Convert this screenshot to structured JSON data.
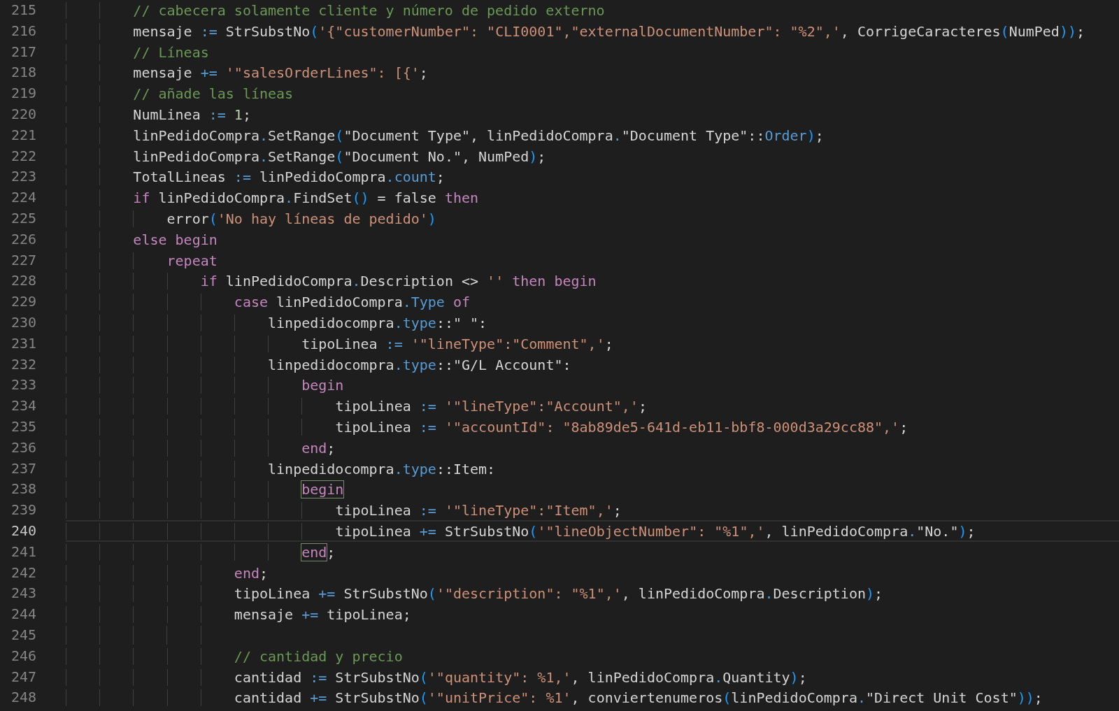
{
  "editor": {
    "lines": [
      {
        "number": "215",
        "current": false,
        "tokens": [
          {
            "text": "        // cabecera solamente cliente y número de pedido externo",
            "kind": "c"
          }
        ]
      },
      {
        "number": "216",
        "current": false,
        "tokens": [
          {
            "text": "        mensaje",
            "kind": "p"
          },
          {
            "text": " := ",
            "kind": "o"
          },
          {
            "text": "StrSubstNo",
            "kind": "p"
          },
          {
            "text": "(",
            "kind": "b"
          },
          {
            "text": "'{\"customerNumber\": \"CLI0001\",\"externalDocumentNumber\": \"%2\",'",
            "kind": "s"
          },
          {
            "text": ", CorrigeCaracteres",
            "kind": "p"
          },
          {
            "text": "(",
            "kind": "b"
          },
          {
            "text": "NumPed",
            "kind": "p"
          },
          {
            "text": "))",
            "kind": "b"
          },
          {
            "text": ";",
            "kind": "p"
          }
        ]
      },
      {
        "number": "217",
        "current": false,
        "tokens": [
          {
            "text": "        // Líneas",
            "kind": "c"
          }
        ]
      },
      {
        "number": "218",
        "current": false,
        "tokens": [
          {
            "text": "        mensaje",
            "kind": "p"
          },
          {
            "text": " += ",
            "kind": "o"
          },
          {
            "text": "'\"salesOrderLines\": [{'",
            "kind": "s"
          },
          {
            "text": ";",
            "kind": "p"
          }
        ]
      },
      {
        "number": "219",
        "current": false,
        "tokens": [
          {
            "text": "        // añade las líneas",
            "kind": "c"
          }
        ]
      },
      {
        "number": "220",
        "current": false,
        "tokens": [
          {
            "text": "        NumLinea",
            "kind": "p"
          },
          {
            "text": " := ",
            "kind": "o"
          },
          {
            "text": "1",
            "kind": "n"
          },
          {
            "text": ";",
            "kind": "p"
          }
        ]
      },
      {
        "number": "221",
        "current": false,
        "tokens": [
          {
            "text": "        linPedidoCompra",
            "kind": "p"
          },
          {
            "text": ".",
            "kind": "o"
          },
          {
            "text": "SetRange",
            "kind": "p"
          },
          {
            "text": "(",
            "kind": "b"
          },
          {
            "text": "\"Document Type\", linPedidoCompra",
            "kind": "p"
          },
          {
            "text": ".",
            "kind": "o"
          },
          {
            "text": "\"Document Type\"::",
            "kind": "p"
          },
          {
            "text": "Order",
            "kind": "o"
          },
          {
            "text": ")",
            "kind": "b"
          },
          {
            "text": ";",
            "kind": "p"
          }
        ]
      },
      {
        "number": "222",
        "current": false,
        "tokens": [
          {
            "text": "        linPedidoCompra",
            "kind": "p"
          },
          {
            "text": ".",
            "kind": "o"
          },
          {
            "text": "SetRange",
            "kind": "p"
          },
          {
            "text": "(",
            "kind": "b"
          },
          {
            "text": "\"Document No.\", NumPed",
            "kind": "p"
          },
          {
            "text": ")",
            "kind": "b"
          },
          {
            "text": ";",
            "kind": "p"
          }
        ]
      },
      {
        "number": "223",
        "current": false,
        "tokens": [
          {
            "text": "        TotalLineas",
            "kind": "p"
          },
          {
            "text": " := ",
            "kind": "o"
          },
          {
            "text": "linPedidoCompra",
            "kind": "p"
          },
          {
            "text": ".count",
            "kind": "o"
          },
          {
            "text": ";",
            "kind": "p"
          }
        ]
      },
      {
        "number": "224",
        "current": false,
        "tokens": [
          {
            "text": "        if",
            "kind": "k"
          },
          {
            "text": " linPedidoCompra",
            "kind": "p"
          },
          {
            "text": ".",
            "kind": "o"
          },
          {
            "text": "FindSet",
            "kind": "p"
          },
          {
            "text": "()",
            "kind": "b"
          },
          {
            "text": " = false ",
            "kind": "p"
          },
          {
            "text": "then",
            "kind": "k"
          }
        ]
      },
      {
        "number": "225",
        "current": false,
        "tokens": [
          {
            "text": "            error",
            "kind": "p"
          },
          {
            "text": "(",
            "kind": "b"
          },
          {
            "text": "'No hay líneas de pedido'",
            "kind": "s"
          },
          {
            "text": ")",
            "kind": "b"
          }
        ]
      },
      {
        "number": "226",
        "current": false,
        "tokens": [
          {
            "text": "        else begin",
            "kind": "k"
          }
        ]
      },
      {
        "number": "227",
        "current": false,
        "tokens": [
          {
            "text": "            repeat",
            "kind": "k"
          }
        ]
      },
      {
        "number": "228",
        "current": false,
        "tokens": [
          {
            "text": "                if",
            "kind": "k"
          },
          {
            "text": " linPedidoCompra",
            "kind": "p"
          },
          {
            "text": ".",
            "kind": "o"
          },
          {
            "text": "Description <> ",
            "kind": "p"
          },
          {
            "text": "''",
            "kind": "s"
          },
          {
            "text": " then begin",
            "kind": "k"
          }
        ]
      },
      {
        "number": "229",
        "current": false,
        "tokens": [
          {
            "text": "                    case",
            "kind": "k"
          },
          {
            "text": " linPedidoCompra",
            "kind": "p"
          },
          {
            "text": ".Type",
            "kind": "o"
          },
          {
            "text": " of",
            "kind": "k"
          }
        ]
      },
      {
        "number": "230",
        "current": false,
        "tokens": [
          {
            "text": "                        linpedidocompra",
            "kind": "p"
          },
          {
            "text": ".type",
            "kind": "o"
          },
          {
            "text": "::\" \":",
            "kind": "p"
          }
        ]
      },
      {
        "number": "231",
        "current": false,
        "tokens": [
          {
            "text": "                            tipoLinea",
            "kind": "p"
          },
          {
            "text": " := ",
            "kind": "o"
          },
          {
            "text": "'\"lineType\":\"Comment\",'",
            "kind": "s"
          },
          {
            "text": ";",
            "kind": "p"
          }
        ]
      },
      {
        "number": "232",
        "current": false,
        "tokens": [
          {
            "text": "                        linpedidocompra",
            "kind": "p"
          },
          {
            "text": ".type",
            "kind": "o"
          },
          {
            "text": "::\"G/L Account\":",
            "kind": "p"
          }
        ]
      },
      {
        "number": "233",
        "current": false,
        "tokens": [
          {
            "text": "                            begin",
            "kind": "k"
          }
        ]
      },
      {
        "number": "234",
        "current": false,
        "tokens": [
          {
            "text": "                                tipoLinea",
            "kind": "p"
          },
          {
            "text": " := ",
            "kind": "o"
          },
          {
            "text": "'\"lineType\":\"Account\",'",
            "kind": "s"
          },
          {
            "text": ";",
            "kind": "p"
          }
        ]
      },
      {
        "number": "235",
        "current": false,
        "tokens": [
          {
            "text": "                                tipoLinea",
            "kind": "p"
          },
          {
            "text": " := ",
            "kind": "o"
          },
          {
            "text": "'\"accountId\": \"8ab89de5-641d-eb11-bbf8-000d3a29cc88\",'",
            "kind": "s"
          },
          {
            "text": ";",
            "kind": "p"
          }
        ]
      },
      {
        "number": "236",
        "current": false,
        "tokens": [
          {
            "text": "                            end",
            "kind": "k"
          },
          {
            "text": ";",
            "kind": "p"
          }
        ]
      },
      {
        "number": "237",
        "current": false,
        "tokens": [
          {
            "text": "                        linpedidocompra",
            "kind": "p"
          },
          {
            "text": ".type",
            "kind": "o"
          },
          {
            "text": "::Item:",
            "kind": "p"
          }
        ]
      },
      {
        "number": "238",
        "current": false,
        "tokens": [
          {
            "text": "                            begin",
            "kind": "match"
          }
        ]
      },
      {
        "number": "239",
        "current": false,
        "tokens": [
          {
            "text": "                                tipoLinea",
            "kind": "p"
          },
          {
            "text": " := ",
            "kind": "o"
          },
          {
            "text": "'\"lineType\":\"Item\",'",
            "kind": "s"
          },
          {
            "text": ";",
            "kind": "p"
          }
        ]
      },
      {
        "number": "240",
        "current": true,
        "tokens": [
          {
            "text": "                                tipoLinea",
            "kind": "p"
          },
          {
            "text": " += ",
            "kind": "o"
          },
          {
            "text": "StrSubstNo",
            "kind": "p"
          },
          {
            "text": "(",
            "kind": "b"
          },
          {
            "text": "'\"lineObjectNumber\": \"%1\",'",
            "kind": "s"
          },
          {
            "text": ", linPedidoCompra",
            "kind": "p"
          },
          {
            "text": ".",
            "kind": "o"
          },
          {
            "text": "\"No.\"",
            "kind": "p"
          },
          {
            "text": ")",
            "kind": "b"
          },
          {
            "text": ";",
            "kind": "p"
          }
        ]
      },
      {
        "number": "241",
        "current": false,
        "tokens": [
          {
            "text": "                            end",
            "kind": "match"
          },
          {
            "text": ";",
            "kind": "p"
          }
        ]
      },
      {
        "number": "242",
        "current": false,
        "tokens": [
          {
            "text": "                    end",
            "kind": "k"
          },
          {
            "text": ";",
            "kind": "p"
          }
        ]
      },
      {
        "number": "243",
        "current": false,
        "tokens": [
          {
            "text": "                    tipoLinea",
            "kind": "p"
          },
          {
            "text": " += ",
            "kind": "o"
          },
          {
            "text": "StrSubstNo",
            "kind": "p"
          },
          {
            "text": "(",
            "kind": "b"
          },
          {
            "text": "'\"description\": \"%1\",'",
            "kind": "s"
          },
          {
            "text": ", linPedidoCompra",
            "kind": "p"
          },
          {
            "text": ".",
            "kind": "o"
          },
          {
            "text": "Description",
            "kind": "p"
          },
          {
            "text": ")",
            "kind": "b"
          },
          {
            "text": ";",
            "kind": "p"
          }
        ]
      },
      {
        "number": "244",
        "current": false,
        "tokens": [
          {
            "text": "                    mensaje",
            "kind": "p"
          },
          {
            "text": " += ",
            "kind": "o"
          },
          {
            "text": "tipoLinea;",
            "kind": "p"
          }
        ]
      },
      {
        "number": "245",
        "current": false
      },
      {
        "number": "246",
        "current": false,
        "tokens": [
          {
            "text": "                    // cantidad y precio",
            "kind": "c"
          }
        ]
      },
      {
        "number": "247",
        "current": false,
        "tokens": [
          {
            "text": "                    cantidad",
            "kind": "p"
          },
          {
            "text": " := ",
            "kind": "o"
          },
          {
            "text": "StrSubstNo",
            "kind": "p"
          },
          {
            "text": "(",
            "kind": "b"
          },
          {
            "text": "'\"quantity\": %1,'",
            "kind": "s"
          },
          {
            "text": ", linPedidoCompra",
            "kind": "p"
          },
          {
            "text": ".",
            "kind": "o"
          },
          {
            "text": "Quantity",
            "kind": "p"
          },
          {
            "text": ")",
            "kind": "b"
          },
          {
            "text": ";",
            "kind": "p"
          }
        ]
      },
      {
        "number": "248",
        "current": false,
        "tokens": [
          {
            "text": "                    cantidad",
            "kind": "p"
          },
          {
            "text": " += ",
            "kind": "o"
          },
          {
            "text": "StrSubstNo",
            "kind": "p"
          },
          {
            "text": "(",
            "kind": "b"
          },
          {
            "text": "'\"unitPrice\": %1'",
            "kind": "s"
          },
          {
            "text": ", conviertenumeros",
            "kind": "p"
          },
          {
            "text": "(",
            "kind": "b"
          },
          {
            "text": "linPedidoCompra",
            "kind": "p"
          },
          {
            "text": ".",
            "kind": "o"
          },
          {
            "text": "\"Direct Unit Cost\"",
            "kind": "p"
          },
          {
            "text": "))",
            "kind": "b"
          },
          {
            "text": ";",
            "kind": "p"
          }
        ]
      }
    ]
  }
}
